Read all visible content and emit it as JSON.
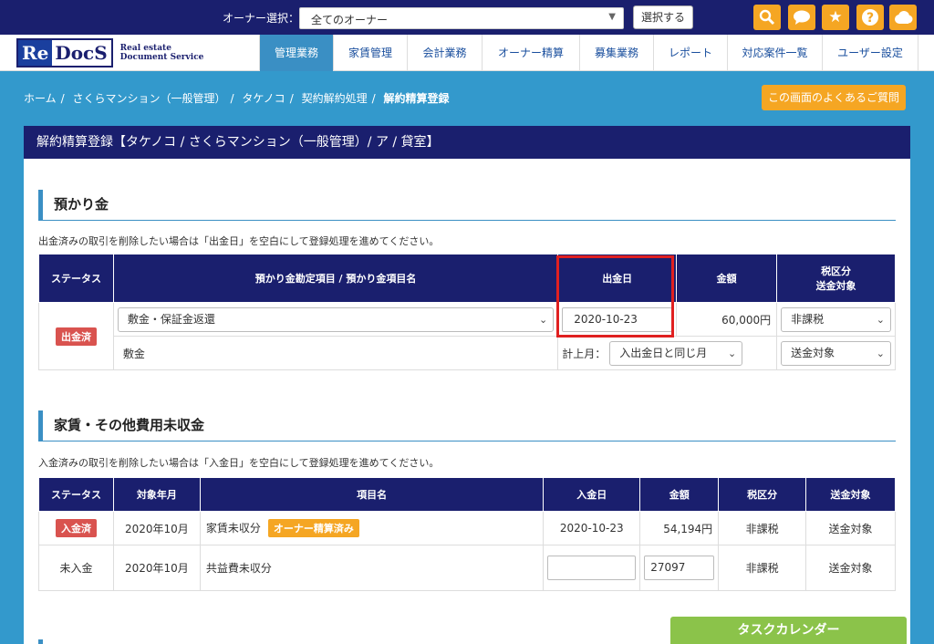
{
  "topbar": {
    "owner_label": "オーナー選択：",
    "owner_selected": "全てのオーナー",
    "select_button": "選択する",
    "icons": [
      "search-icon",
      "chat-icon",
      "star-icon",
      "help-icon",
      "cloud-icon"
    ]
  },
  "logo": {
    "re": "Re",
    "docs": "DocS",
    "sub1": "Real estate",
    "sub2": "Document Service"
  },
  "nav": [
    "管理業務",
    "家賃管理",
    "会計業務",
    "オーナー精算",
    "募集業務",
    "レポート",
    "対応案件一覧",
    "ユーザー設定"
  ],
  "breadcrumb": {
    "items": [
      "ホーム",
      "さくらマンション（一般管理）",
      "タケノコ",
      "契約解約処理"
    ],
    "current": "解約精算登録"
  },
  "faq_button": "この画面のよくあるご質問",
  "panel_title": "解約精算登録【タケノコ / さくらマンション（一般管理）/ ア / 貸室】",
  "deposit": {
    "heading": "預かり金",
    "note": "出金済みの取引を削除したい場合は「出金日」を空白にして登録処理を進めてください。",
    "headers": [
      "ステータス",
      "預かり金勘定項目 / 預かり金項目名",
      "出金日",
      "金額",
      "税区分",
      "送金対象"
    ],
    "status": "出金済",
    "account_item": "敷金・保証金返還",
    "item_name": "敷金",
    "withdraw_date": "2020-10-23",
    "amount": "60,000円",
    "tax": "非課税",
    "posting_label": "計上月：",
    "posting_month": "入出金日と同じ月",
    "remit": "送金対象"
  },
  "rent": {
    "heading": "家賃・その他費用未収金",
    "note": "入金済みの取引を削除したい場合は「入金日」を空白にして登録処理を進めてください。",
    "headers": [
      "ステータス",
      "対象年月",
      "項目名",
      "入金日",
      "金額",
      "税区分",
      "送金対象"
    ],
    "rows": [
      {
        "status": "入金済",
        "month": "2020年10月",
        "item": "家賃未収分",
        "badge": "オーナー精算済み",
        "date": "2020-10-23",
        "amount": "54,194円",
        "tax": "非課税",
        "remit": "送金対象"
      },
      {
        "status": "未入金",
        "month": "2020年10月",
        "item": "共益費未収分",
        "date": "",
        "amount": "27097",
        "tax": "非課税",
        "remit": "送金対象"
      }
    ]
  },
  "task_calendar": "タスクカレンダー"
}
